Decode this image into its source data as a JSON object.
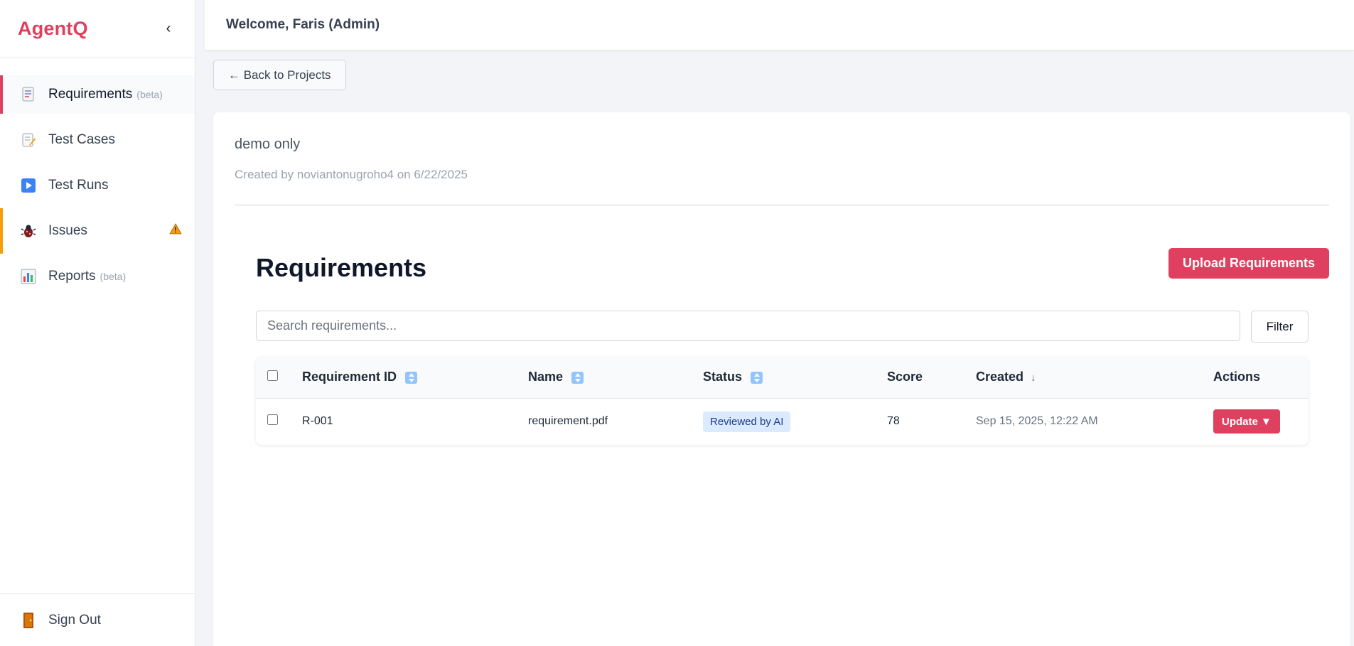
{
  "sidebar": {
    "brand": "AgentQ",
    "collapse": "‹",
    "items": [
      {
        "label": "Requirements",
        "tag": "(beta)"
      },
      {
        "label": "Test Cases"
      },
      {
        "label": "Test Runs"
      },
      {
        "label": "Issues"
      },
      {
        "label": "Reports",
        "tag": "(beta)"
      }
    ],
    "sign_out": "Sign Out"
  },
  "header": {
    "welcome": "Welcome, Faris (Admin)"
  },
  "back_button": "← Back to Projects",
  "project": {
    "name": "demo only",
    "meta": "Created by noviantonugroho4 on 6/22/2025"
  },
  "requirements": {
    "title": "Requirements",
    "upload_label": "Upload Requirements",
    "search_placeholder": "Search requirements...",
    "filter_label": "Filter",
    "columns": {
      "id": "Requirement ID",
      "name": "Name",
      "status": "Status",
      "score": "Score",
      "created": "Created",
      "created_sort": "↓",
      "actions": "Actions"
    },
    "rows": [
      {
        "id": "R-001",
        "name": "requirement.pdf",
        "status": "Reviewed by AI",
        "score": "78",
        "created": "Sep 15, 2025, 12:22 AM",
        "action": "Update ▼"
      }
    ]
  },
  "colors": {
    "accent": "#e0405f",
    "warning": "#f59e0b",
    "badge_bg": "#dbeafe"
  },
  "icons": [
    "requirements-icon",
    "test-cases-icon",
    "test-runs-icon",
    "issues-icon",
    "reports-icon",
    "warning-icon",
    "sign-out-icon",
    "sort-icon"
  ]
}
